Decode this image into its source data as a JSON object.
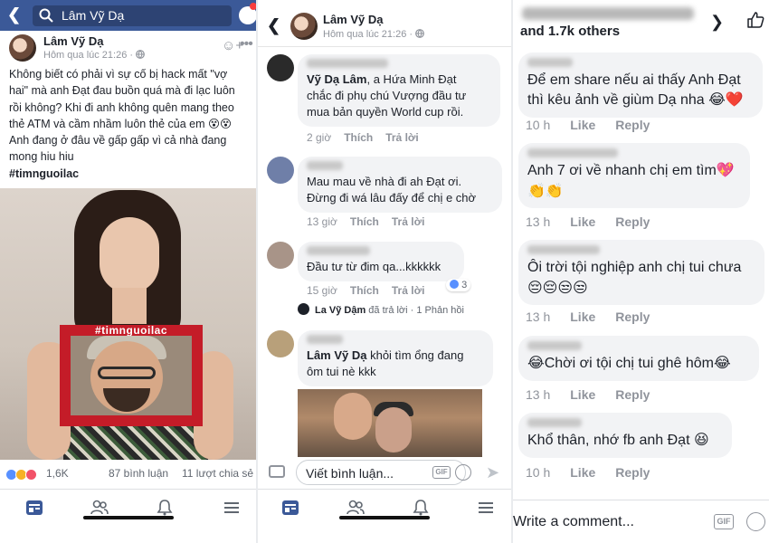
{
  "panel1": {
    "search": {
      "value": "Lâm Vỹ Dạ"
    },
    "post": {
      "author": "Lâm Vỹ Dạ",
      "time": "Hôm qua lúc 21:26 · ",
      "text_lines": [
        "Không biết có phải vì sự cố bị hack mất \"vợ",
        "hai\" mà anh Đạt đau buồn quá mà đi lạc luôn",
        "rồi không? Khi đi anh không quên mang theo",
        "thẻ ATM và cầm nhầm luôn thẻ của em 😵😵",
        "Anh đang ở đâu về gấp gấp vì cả nhà đang",
        "mong hiu hiu"
      ],
      "hashtag": "#timnguoilac",
      "frame_text": "#timnguoilac"
    },
    "stats": {
      "reactions": "1,6K",
      "comments": "87 bình luận",
      "shares": "11 lượt chia sẻ"
    },
    "nav": [
      "news-feed-icon",
      "friends-icon",
      "notifications-icon",
      "menu-icon"
    ]
  },
  "panel2": {
    "header": {
      "author": "Lâm Vỹ Dạ",
      "time": "Hôm qua lúc 21:26 · "
    },
    "comments": [
      {
        "mention": "Vỹ Dạ Lâm",
        "text_a": ", a Hứa Minh Đạt",
        "text_b": "chắc đi phụ chú Vượng đầu tư",
        "text_c": "mua bản quyền World cup rồi.",
        "time": "2 giờ",
        "like": "Thích",
        "reply": "Trả lời"
      },
      {
        "text_a": "Mau mau về nhà đi ah Đạt ơi.",
        "text_b": "Đừng đi wá lâu đấy để chị e chờ",
        "time": "13 giờ",
        "like": "Thích",
        "reply": "Trả lời"
      },
      {
        "text_a": "Đầu tư từ đim qa...kkkkkk",
        "time": "15 giờ",
        "like": "Thích",
        "reply": "Trả lời",
        "likes_count": "3"
      },
      {
        "mention": "Lâm Vỹ Dạ",
        "text_a": " khỏi tìm ổng đang",
        "text_b": "ôm tui nè kkk"
      }
    ],
    "reply_line": {
      "name": "La Vỹ Dậm",
      "action": " đã trả lời · 1 Phản hồi"
    },
    "composer_placeholder": "Viết bình luận...",
    "gif": "GIF",
    "nav": [
      "news-feed-icon",
      "friends-icon",
      "notifications-icon",
      "menu-icon"
    ]
  },
  "panel3": {
    "header": {
      "others": "and 1.7k others"
    },
    "comments": [
      {
        "line1": "Để em share nếu ai thấy Anh Đạt",
        "line2": "thì kêu ảnh về giùm Dạ nha 😂❤️",
        "time": "10 h",
        "like": "Like",
        "reply": "Reply"
      },
      {
        "line1": "Anh 7 ơi về nhanh chị em tìm💖",
        "line2": "👏👏",
        "time": "13 h",
        "like": "Like",
        "reply": "Reply"
      },
      {
        "line1": "Ôi trời tội nghiệp anh chị tui chưa",
        "line2": "😔😔😒😒",
        "time": "13 h",
        "like": "Like",
        "reply": "Reply"
      },
      {
        "line1": "😂Chời ơi tội chị tui ghê hôm😂",
        "time": "13 h",
        "like": "Like",
        "reply": "Reply"
      },
      {
        "line1": "Khổ thân, nhớ fb anh Đạt 😆",
        "time": "10 h",
        "like": "Like",
        "reply": "Reply"
      }
    ],
    "composer_placeholder": "Write a comment...",
    "gif": "GIF"
  },
  "colors": {
    "facebook_blue": "#3b5998",
    "link_blue": "#385898",
    "bubble_gray": "#f2f3f5",
    "meta_gray": "#90949c"
  }
}
